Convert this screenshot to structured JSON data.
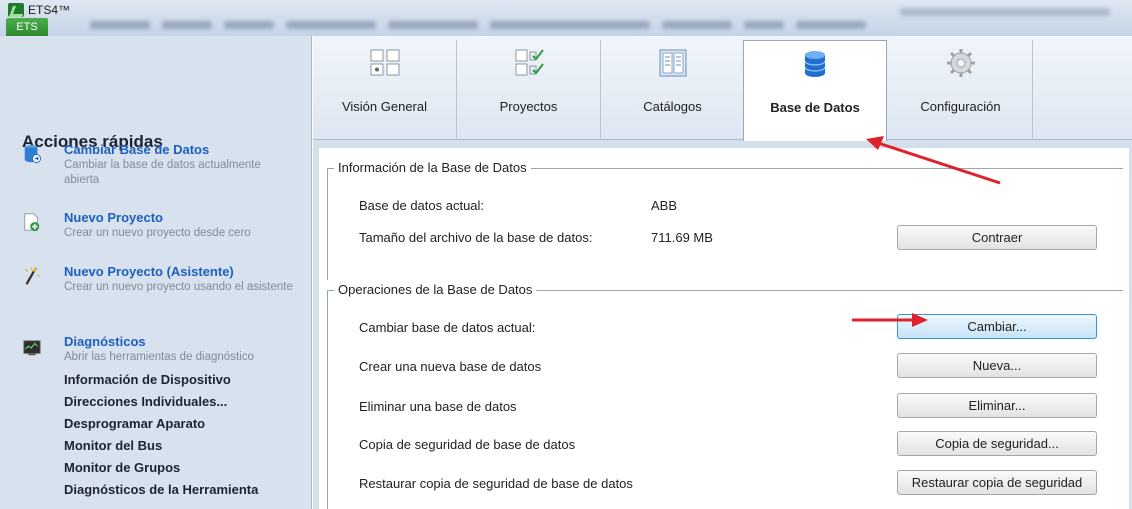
{
  "app": {
    "title": "ETS4™",
    "ribbon_tab": "ETS"
  },
  "sidebar": {
    "header": "Acciones rápidas",
    "items": [
      {
        "title": "Cambiar Base de Datos",
        "description": "Cambiar la base de datos actualmente abierta",
        "icon": "database-switch-icon"
      },
      {
        "title": "Nuevo Proyecto",
        "description": "Crear un nuevo proyecto desde cero",
        "icon": "new-project-icon"
      },
      {
        "title": "Nuevo Proyecto (Asistente)",
        "description": "Crear un nuevo proyecto usando el asistente",
        "icon": "wizard-icon"
      },
      {
        "title": "Diagnósticos",
        "description": "Abrir las herramientas de diagnóstico",
        "icon": "diagnostics-icon"
      }
    ],
    "diagnostics": [
      "Información de Dispositivo",
      "Direcciones Individuales...",
      "Desprogramar Aparato",
      "Monitor del Bus",
      "Monitor de Grupos",
      "Diagnósticos de la Herramienta"
    ]
  },
  "tabs": [
    {
      "label": "Visión General",
      "icon": "overview-icon"
    },
    {
      "label": "Proyectos",
      "icon": "projects-icon"
    },
    {
      "label": "Catálogos",
      "icon": "catalog-icon"
    },
    {
      "label": "Base de Datos",
      "icon": "database-icon",
      "active": true
    },
    {
      "label": "Configuración",
      "icon": "gear-icon"
    }
  ],
  "info": {
    "legend": "Información de la Base de Datos",
    "current_label": "Base de datos actual:",
    "current_value": "ABB",
    "size_label": "Tamaño del archivo de la base de datos:",
    "size_value": "711.69 MB",
    "compact_button": "Contraer"
  },
  "operations": {
    "legend": "Operaciones de la Base de Datos",
    "rows": [
      {
        "label": "Cambiar base de datos actual:",
        "button": "Cambiar..."
      },
      {
        "label": "Crear una nueva base de datos",
        "button": "Nueva..."
      },
      {
        "label": "Eliminar una base de datos",
        "button": "Eliminar..."
      },
      {
        "label": "Copia de seguridad de base de datos",
        "button": "Copia de seguridad..."
      },
      {
        "label": "Restaurar copia de seguridad de base de datos",
        "button": "Restaurar copia de seguridad"
      }
    ]
  },
  "colors": {
    "accent": "#1d5fbf",
    "annotation_arrow": "#e0202a",
    "app_green": "#2c8a2e"
  }
}
